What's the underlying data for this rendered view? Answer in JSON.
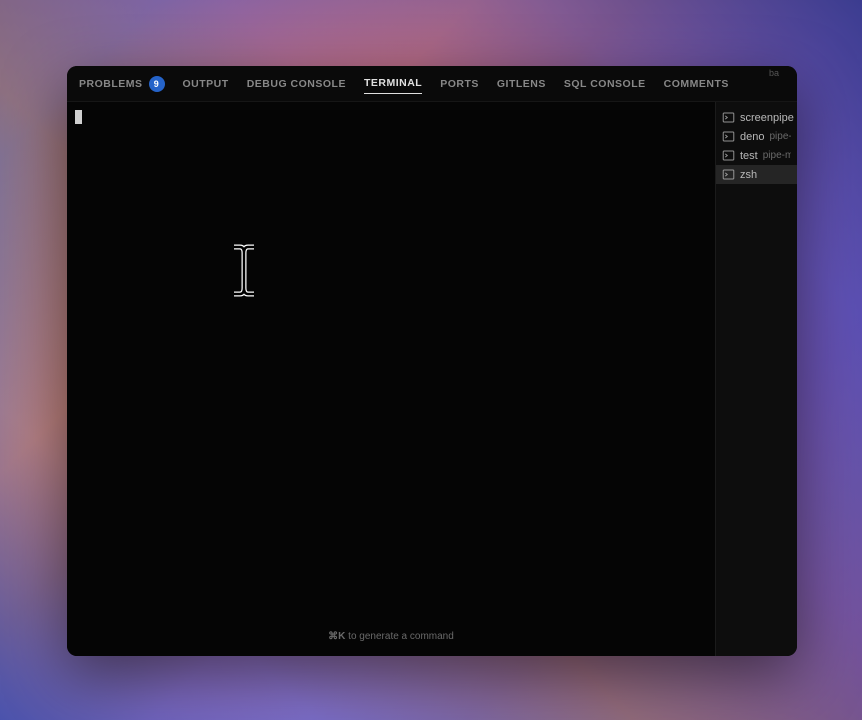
{
  "tabs": {
    "problems": {
      "label": "PROBLEMS",
      "badge": "9"
    },
    "output": {
      "label": "OUTPUT"
    },
    "debug_console": {
      "label": "DEBUG CONSOLE"
    },
    "terminal": {
      "label": "TERMINAL"
    },
    "ports": {
      "label": "PORTS"
    },
    "gitlens": {
      "label": "GITLENS"
    },
    "sql_console": {
      "label": "SQL CONSOLE"
    },
    "comments": {
      "label": "COMMENTS"
    }
  },
  "terminals": [
    {
      "name": "screenpipe",
      "sub": ""
    },
    {
      "name": "deno",
      "sub": "pipe-"
    },
    {
      "name": "test",
      "sub": "pipe-m"
    },
    {
      "name": "zsh",
      "sub": ""
    }
  ],
  "hint": {
    "key": "⌘K",
    "text": " to generate a command"
  },
  "toolbar_hint": "ba"
}
